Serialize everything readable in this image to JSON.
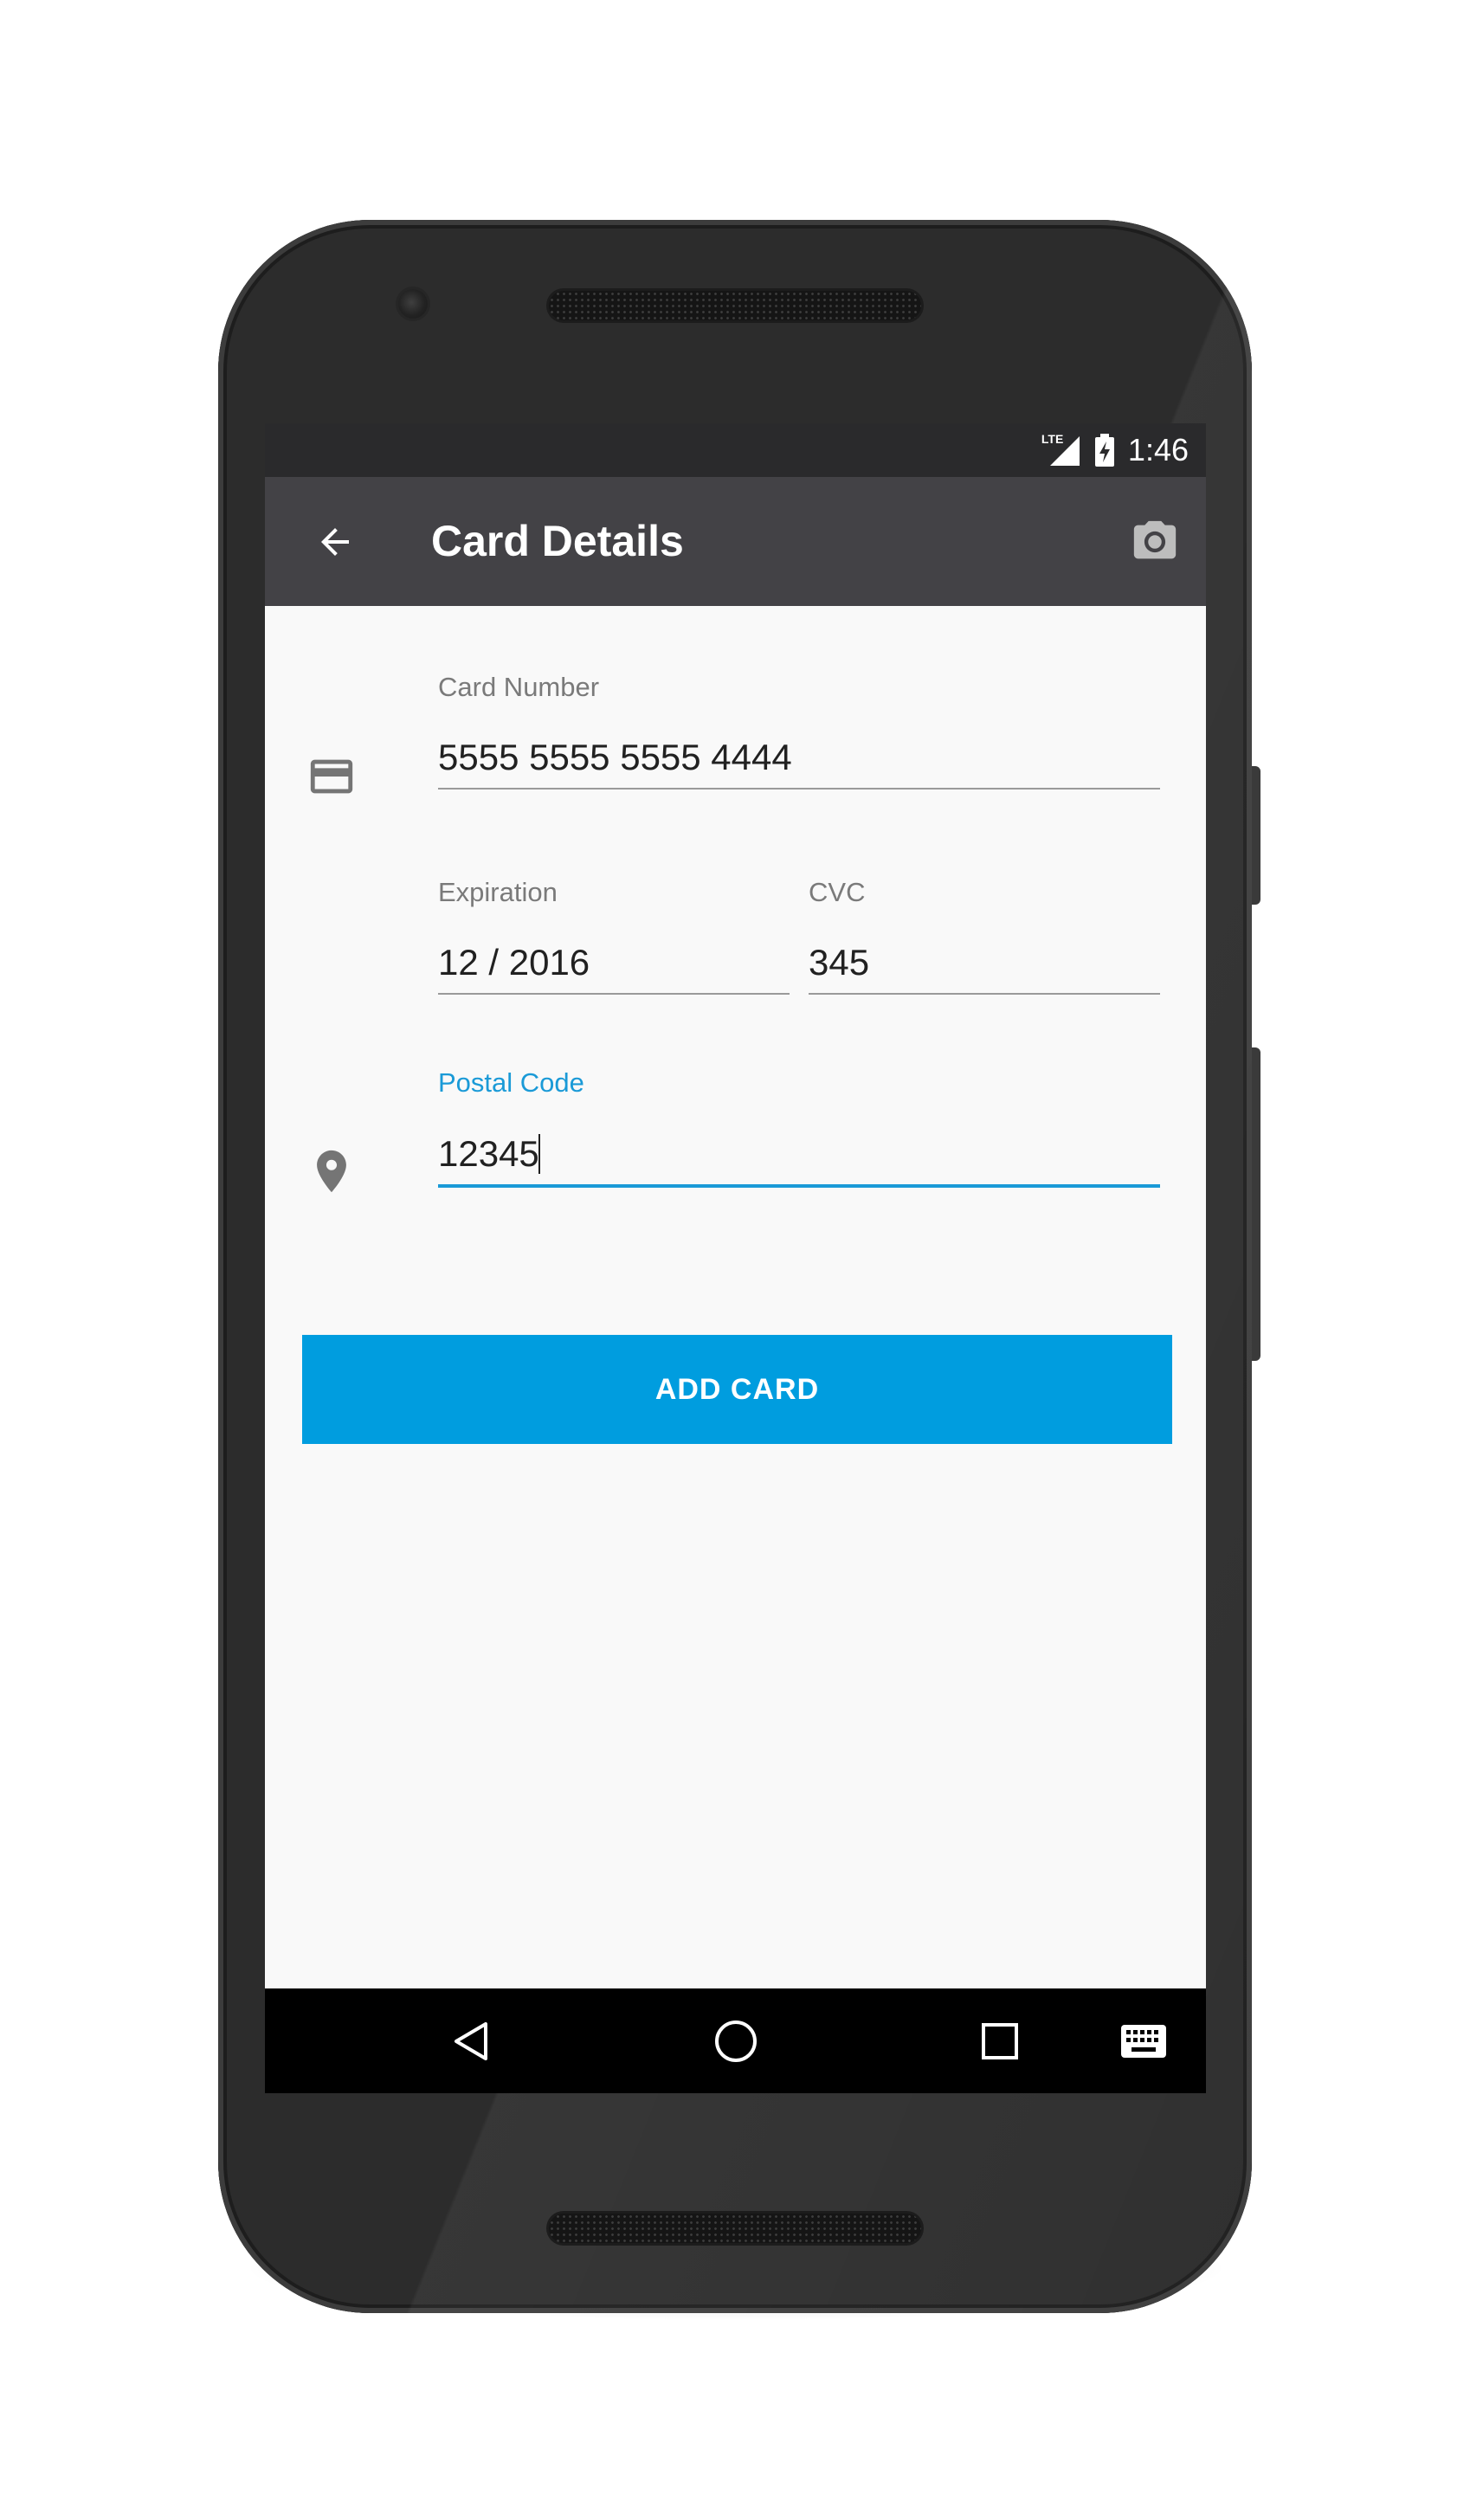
{
  "status_bar": {
    "network_label": "LTE",
    "time": "1:46"
  },
  "app_bar": {
    "title": "Card Details",
    "back_icon": "arrow-back-icon",
    "action_icon": "camera-icon"
  },
  "form": {
    "card_number": {
      "label": "Card Number",
      "value": "5555 5555 5555 4444",
      "icon": "credit-card-icon"
    },
    "expiration": {
      "label": "Expiration",
      "value": "12 / 2016"
    },
    "cvc": {
      "label": "CVC",
      "value": "345"
    },
    "postal_code": {
      "label": "Postal Code",
      "value": "12345",
      "icon": "location-pin-icon",
      "focused": true
    }
  },
  "actions": {
    "add_card_label": "ADD CARD"
  },
  "nav_bar": {
    "keys": [
      "back-triangle-icon",
      "home-circle-icon",
      "recents-square-icon",
      "keyboard-icon"
    ]
  },
  "colors": {
    "accent": "#009ddf",
    "focus": "#1a9ad7",
    "app_bar": "#434246",
    "status_bar": "#2a2a2c",
    "screen_bg": "#f9f9f9"
  }
}
